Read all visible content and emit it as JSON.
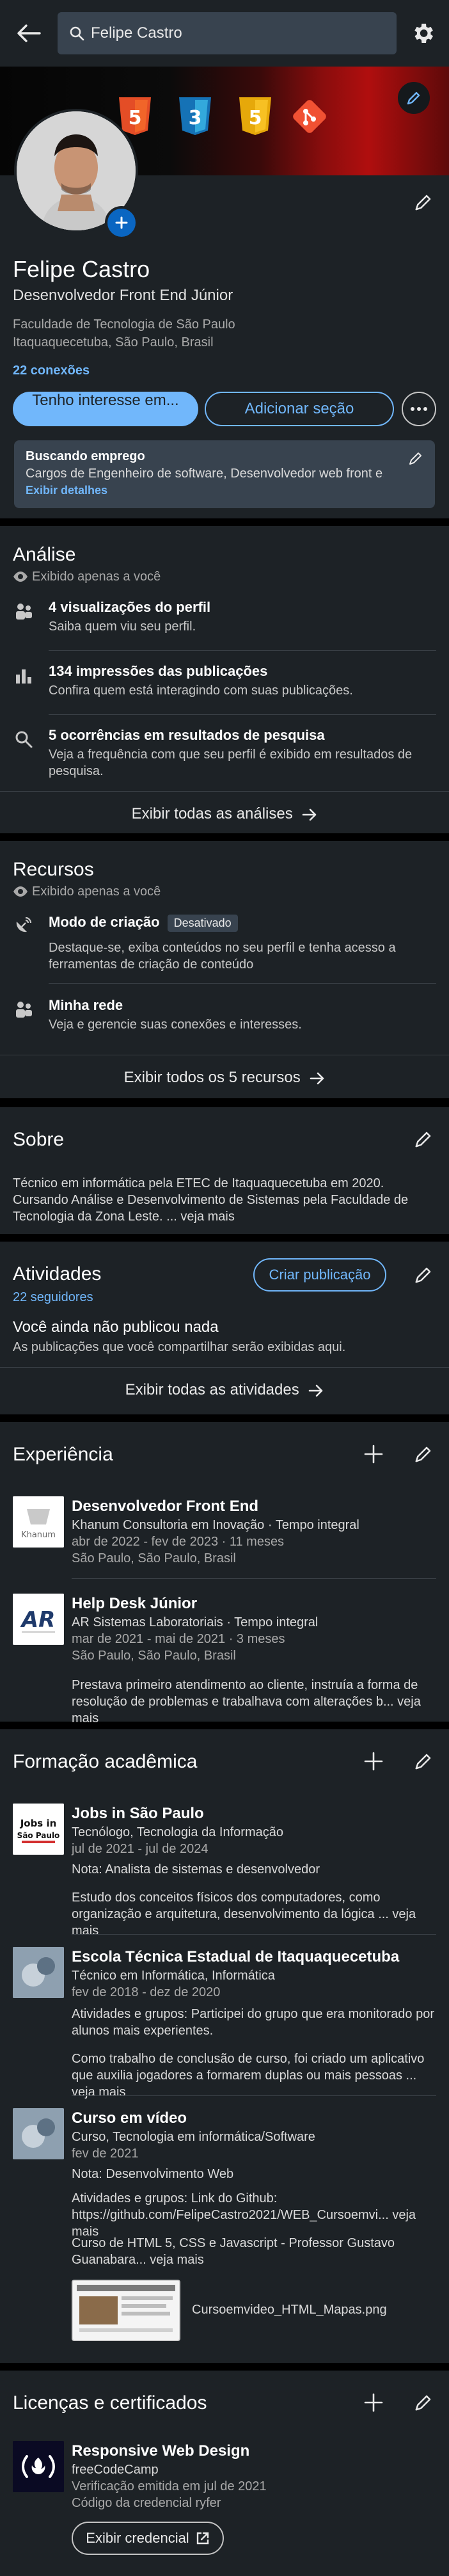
{
  "topbar": {
    "search_value": "Felipe Castro"
  },
  "profile": {
    "name": "Felipe Castro",
    "headline": "Desenvolvedor Front End Júnior",
    "school": "Faculdade de Tecnologia de São Paulo",
    "location": "Itaquaquecetuba, São Paulo, Brasil",
    "connections": "22 conexões",
    "btn_interest": "Tenho interesse em...",
    "btn_add_section": "Adicionar seção",
    "job_box": {
      "title": "Buscando emprego",
      "desc": "Cargos de Engenheiro de software, Desenvolvedor web front e...",
      "link": "Exibir detalhes"
    }
  },
  "analysis": {
    "title": "Análise",
    "private": "Exibido apenas a você",
    "items": [
      {
        "title": "4 visualizações do perfil",
        "desc": "Saiba quem viu seu perfil."
      },
      {
        "title": "134 impressões das publicações",
        "desc": "Confira quem está interagindo com suas publicações."
      },
      {
        "title": "5 ocorrências em resultados de pesquisa",
        "desc": "Veja a frequência com que seu perfil é exibido em resultados de pesquisa."
      }
    ],
    "show_all": "Exibir todas as análises"
  },
  "resources": {
    "title": "Recursos",
    "private": "Exibido apenas a você",
    "creator_title": "Modo de criação",
    "creator_badge": "Desativado",
    "creator_desc": "Destaque-se, exiba conteúdos no seu perfil e tenha acesso a ferramentas de criação de conteúdo",
    "network_title": "Minha rede",
    "network_desc": "Veja e gerencie suas conexões e interesses.",
    "show_all": "Exibir todos os 5 recursos"
  },
  "about": {
    "title": "Sobre",
    "text": "Técnico em informática pela ETEC de Itaquaquecetuba em 2020. Cursando Análise e Desenvolvimento de Sistemas pela Faculdade de Tecnologia da Zona Leste. ... veja mais"
  },
  "activity": {
    "title": "Atividades",
    "followers": "22 seguidores",
    "create_post": "Criar publicação",
    "empty_title": "Você ainda não publicou nada",
    "empty_desc": "As publicações que você compartilhar serão exibidas aqui.",
    "show_all": "Exibir todas as atividades"
  },
  "experience": {
    "title": "Experiência",
    "items": [
      {
        "role": "Desenvolvedor Front End",
        "company": "Khanum Consultoria em Inovação · Tempo integral",
        "dates": "abr de 2022 - fev de 2023 · 11 meses",
        "place": "São Paulo, São Paulo, Brasil",
        "logo_text": "Khanum"
      },
      {
        "role": "Help Desk Júnior",
        "company": "AR Sistemas Laboratoriais · Tempo integral",
        "dates": "mar de 2021 - mai de 2021 · 3 meses",
        "place": "São Paulo, São Paulo, Brasil",
        "desc": "Prestava primeiro atendimento ao cliente, instruía a forma de resolução de problemas e trabalhava com alterações b... veja mais",
        "logo_text": "AR"
      }
    ]
  },
  "education": {
    "title": "Formação acadêmica",
    "items": [
      {
        "school": "Jobs in São Paulo",
        "degree": "Tecnólogo, Tecnologia da Informação",
        "dates": "jul de 2021 - jul de 2024",
        "grade": "Nota: Analista de sistemas e desenvolvedor",
        "desc": "Estudo dos conceitos físicos dos computadores, como organização e arquitetura, desenvolvimento da lógica ... veja mais",
        "logo_line1": "Jobs in",
        "logo_line2": "São Paulo"
      },
      {
        "school": "Escola Técnica Estadual de Itaquaquecetuba",
        "degree": "Técnico em Informática, Informática",
        "dates": "fev de 2018 - dez de 2020",
        "activities": "Atividades e grupos: Participei do grupo que era monitorado por alunos mais experientes.",
        "desc": "Como trabalho de conclusão de curso, foi criado um aplicativo que auxilia jogadores a formarem duplas ou mais pessoas ... veja mais"
      },
      {
        "school": "Curso em vídeo",
        "degree": "Curso, Tecnologia em informática/Software",
        "dates": "fev de 2021",
        "grade": "Nota: Desenvolvimento Web",
        "activities": "Atividades e grupos: Link do Github: https://github.com/FelipeCastro2021/WEB_Cursoemvi... veja mais",
        "desc": "Curso de HTML 5, CSS e Javascript - Professor Gustavo Guanabara... veja mais",
        "media_name": "Cursoemvideo_HTML_Mapas.png"
      }
    ]
  },
  "licenses": {
    "title": "Licenças e certificados",
    "items": [
      {
        "name": "Responsive Web Design",
        "issuer": "freeCodeCamp",
        "date": "Verificação emitida em jul de 2021",
        "cred_id": "Código da credencial ryfer",
        "btn": "Exibir credencial"
      }
    ]
  },
  "banner_badges": [
    "5",
    "3",
    "5"
  ]
}
